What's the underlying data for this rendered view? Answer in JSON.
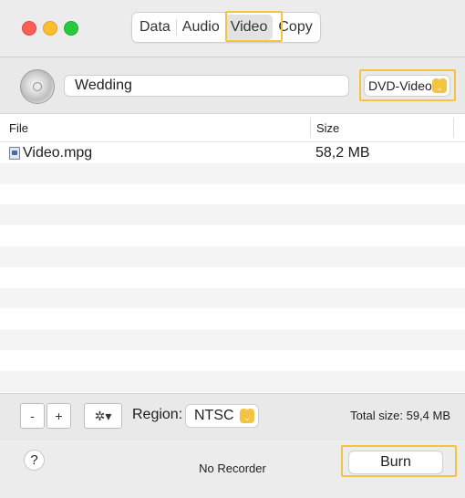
{
  "tabs": [
    {
      "label": "Data"
    },
    {
      "label": "Audio"
    },
    {
      "label": "Video",
      "active": true
    },
    {
      "label": "Copy"
    }
  ],
  "disc": {
    "name_value": "Wedding",
    "format_value": "DVD-Video"
  },
  "table": {
    "columns": {
      "file": "File",
      "size": "Size"
    },
    "rows": [
      {
        "name": "Video.mpg",
        "size": "58,2 MB"
      }
    ]
  },
  "bottom": {
    "minus_label": "-",
    "plus_label": "+",
    "gear_label": "✲▾",
    "region_label": "Region:",
    "region_value": "NTSC",
    "total_size": "Total size: 59,4 MB"
  },
  "footer": {
    "help_label": "?",
    "status": "No Recorder",
    "burn_label": "Burn"
  },
  "colors": {
    "highlight": "#f5c342",
    "close": "#fe5f57",
    "minimize": "#febc2e",
    "zoom": "#28c840"
  },
  "icons": [
    "close-icon",
    "minimize-icon",
    "zoom-icon",
    "disc-icon",
    "video-file-icon",
    "gear-icon",
    "stepper-icon",
    "help-icon"
  ]
}
